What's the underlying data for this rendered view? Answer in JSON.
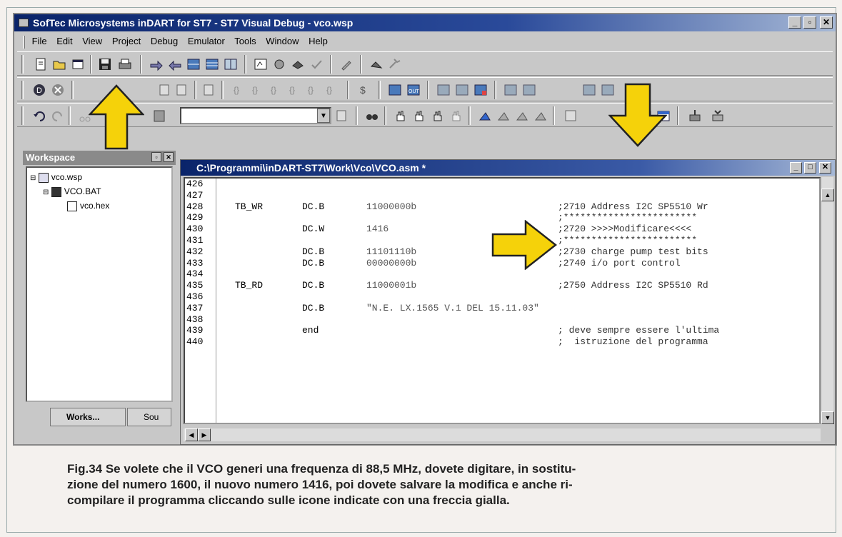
{
  "window": {
    "title": "SofTec Microsystems inDART for ST7 - ST7 Visual Debug - vco.wsp"
  },
  "menu": [
    "File",
    "Edit",
    "View",
    "Project",
    "Debug",
    "Emulator",
    "Tools",
    "Window",
    "Help"
  ],
  "workspace": {
    "title": "Workspace",
    "tree": [
      "vco.wsp",
      "VCO.BAT",
      "vco.hex"
    ],
    "tabs": [
      "Works...",
      "Sou"
    ]
  },
  "editor": {
    "title": "C:\\Programmi\\inDART-ST7\\Work\\Vco\\VCO.asm *",
    "lines": [
      {
        "n": "426",
        "label": "",
        "instr": "",
        "val": "",
        "comment": ""
      },
      {
        "n": "427",
        "label": "",
        "instr": "",
        "val": "",
        "comment": ""
      },
      {
        "n": "428",
        "label": "TB_WR",
        "instr": "DC.B",
        "val": "11000000b",
        "comment": ";2710 Address I2C SP5510 Wr"
      },
      {
        "n": "429",
        "label": "",
        "instr": "",
        "val": "",
        "comment": ";************************"
      },
      {
        "n": "430",
        "label": "",
        "instr": "DC.W",
        "val": "1416",
        "comment": ";2720 >>>>Modificare<<<<"
      },
      {
        "n": "431",
        "label": "",
        "instr": "",
        "val": "",
        "comment": ";************************"
      },
      {
        "n": "432",
        "label": "",
        "instr": "DC.B",
        "val": "11101110b",
        "comment": ";2730 charge pump test bits"
      },
      {
        "n": "433",
        "label": "",
        "instr": "DC.B",
        "val": "00000000b",
        "comment": ";2740 i/o port control"
      },
      {
        "n": "434",
        "label": "",
        "instr": "",
        "val": "",
        "comment": ""
      },
      {
        "n": "435",
        "label": "TB_RD",
        "instr": "DC.B",
        "val": "11000001b",
        "comment": ";2750 Address I2C SP5510 Rd"
      },
      {
        "n": "436",
        "label": "",
        "instr": "",
        "val": "",
        "comment": ""
      },
      {
        "n": "437",
        "label": "",
        "instr": "DC.B",
        "val": "\"N.E. LX.1565 V.1 DEL 15.11.03\"",
        "comment": ""
      },
      {
        "n": "438",
        "label": "",
        "instr": "",
        "val": "",
        "comment": ""
      },
      {
        "n": "439",
        "label": "",
        "instr": "end",
        "val": "",
        "comment": "; deve sempre essere l'ultima"
      },
      {
        "n": "440",
        "label": "",
        "instr": "",
        "val": "",
        "comment": ";  istruzione del programma"
      }
    ]
  },
  "caption": "Fig.34 Se volete che il VCO generi una frequenza di 88,5 MHz, dovete digitare, in sostitu-zione del numero 1600, il nuovo numero 1416, poi dovete salvare la modifica e anche ri-compilare il programma cliccando sulle icone indicate con una freccia gialla.",
  "caption_lines": [
    "Fig.34 Se volete che il VCO generi una frequenza di 88,5 MHz, dovete digitare, in sostitu-",
    "zione del numero 1600, il nuovo numero 1416, poi dovete salvare la modifica e anche ri-",
    "compilare il programma cliccando sulle icone indicate con una freccia gialla."
  ],
  "colors": {
    "arrow_fill": "#f5d20a",
    "arrow_stroke": "#222222",
    "titlebar": "#0a246a"
  },
  "icons": [
    "new-file-icon",
    "open-icon",
    "save-icon",
    "print-icon",
    "build-icon",
    "compile-icon"
  ]
}
